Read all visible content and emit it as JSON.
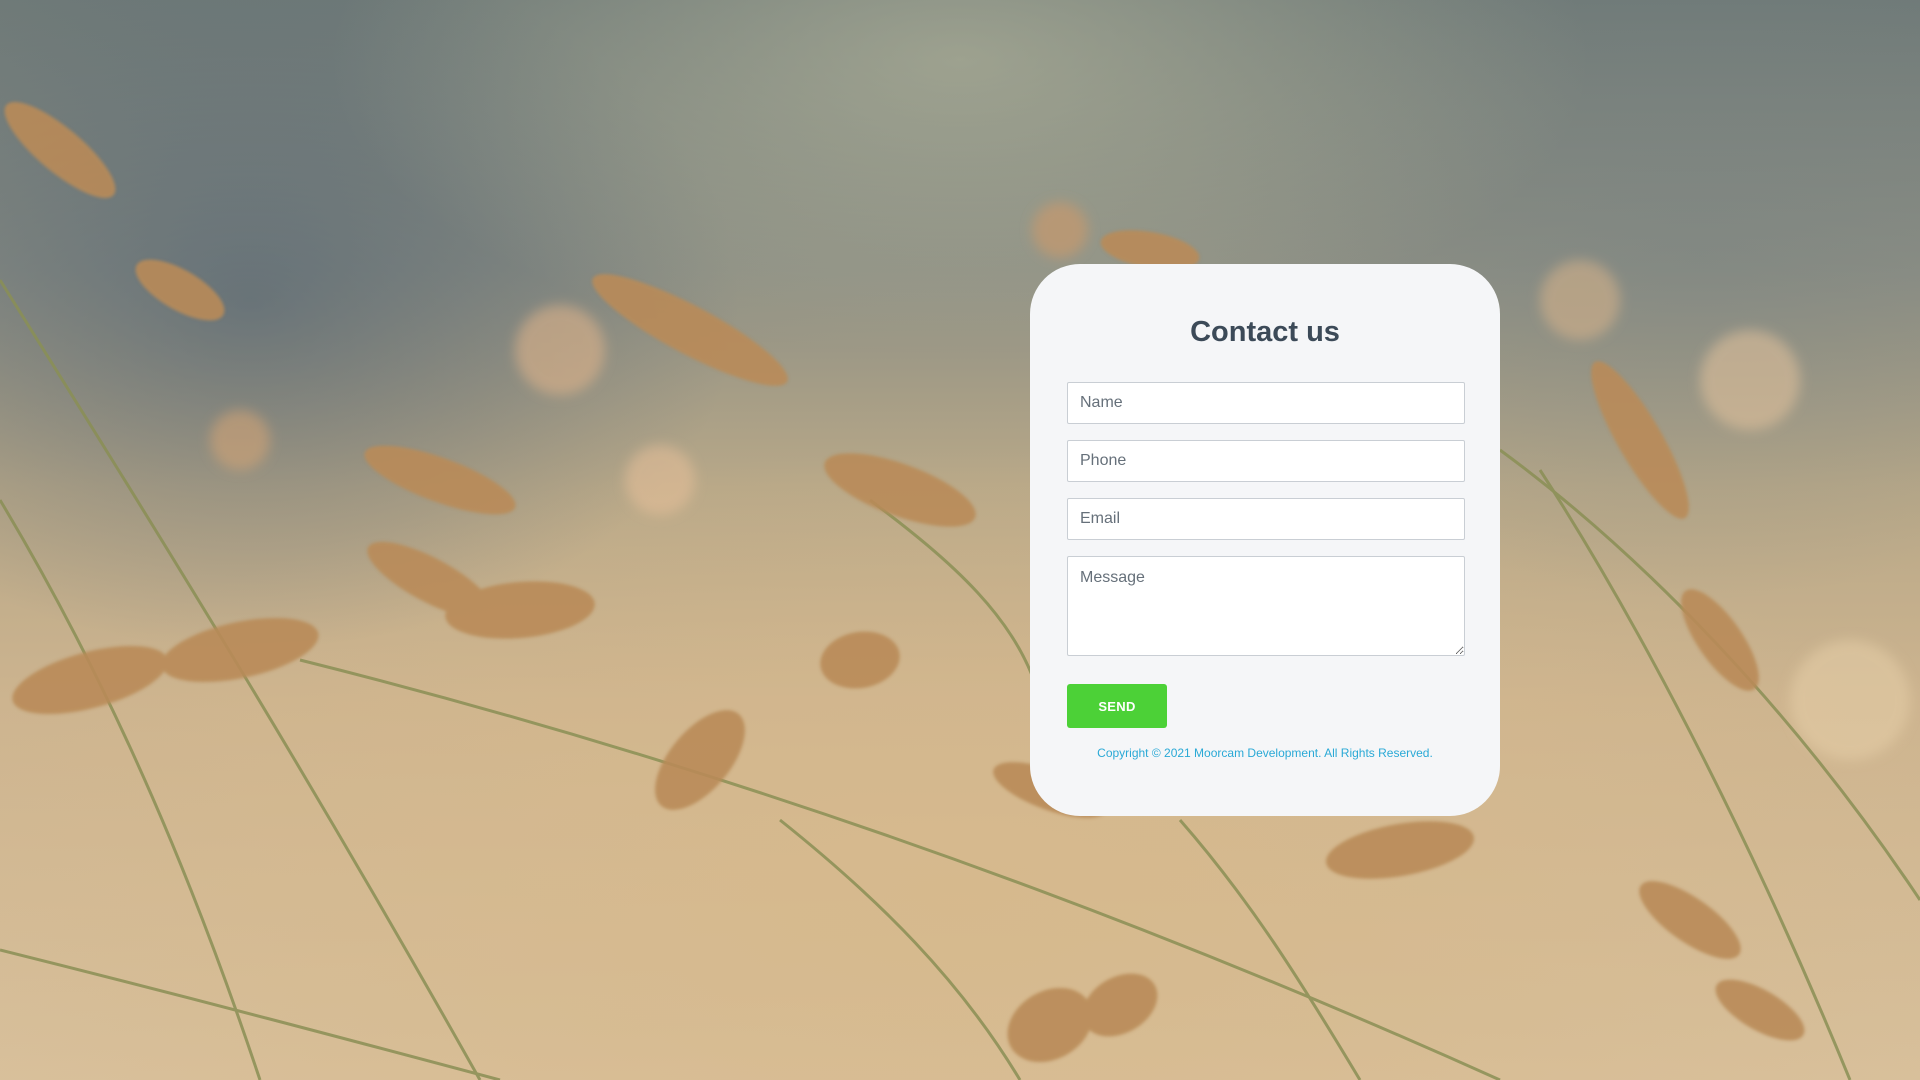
{
  "page": {
    "background_image": "blurred wheat field photo"
  },
  "form": {
    "title": "Contact us",
    "name_placeholder": "Name",
    "phone_placeholder": "Phone",
    "email_placeholder": "Email",
    "message_placeholder": "Message",
    "send_label": "SEND",
    "copyright": "Copyright © 2021 Moorcam Development. All Rights Reserved."
  },
  "colors": {
    "card_background": "#f5f6f8",
    "title_text": "#3c4a58",
    "send_button": "#4cd137",
    "copyright_text": "#2aa9d6"
  }
}
